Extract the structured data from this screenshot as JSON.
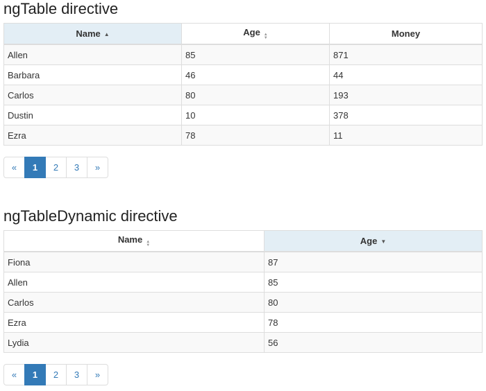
{
  "section1": {
    "title": "ngTable directive",
    "columns": [
      {
        "label": "Name",
        "sort": "asc"
      },
      {
        "label": "Age",
        "sort": "sortable"
      },
      {
        "label": "Money",
        "sort": "none"
      }
    ],
    "rows": [
      [
        "Allen",
        "85",
        "871"
      ],
      [
        "Barbara",
        "46",
        "44"
      ],
      [
        "Carlos",
        "80",
        "193"
      ],
      [
        "Dustin",
        "10",
        "378"
      ],
      [
        "Ezra",
        "78",
        "11"
      ]
    ],
    "pager": {
      "prev": "«",
      "pages": [
        "1",
        "2",
        "3"
      ],
      "next": "»",
      "active_page": "1"
    }
  },
  "section2": {
    "title": "ngTableDynamic directive",
    "columns": [
      {
        "label": "Name",
        "sort": "sortable"
      },
      {
        "label": "Age",
        "sort": "desc"
      }
    ],
    "rows": [
      [
        "Fiona",
        "87"
      ],
      [
        "Allen",
        "85"
      ],
      [
        "Carlos",
        "80"
      ],
      [
        "Ezra",
        "78"
      ],
      [
        "Lydia",
        "56"
      ]
    ],
    "pager": {
      "prev": "«",
      "pages": [
        "1",
        "2",
        "3"
      ],
      "next": "»",
      "active_page": "1"
    }
  },
  "icons": {
    "sort_asc": "▲",
    "sort_desc": "▼",
    "sortable": "▲▼"
  },
  "colors": {
    "link": "#337ab7",
    "sorted_header_bg": "#e3eef5",
    "border": "#dddddd",
    "striped_row": "#f9f9f9"
  }
}
